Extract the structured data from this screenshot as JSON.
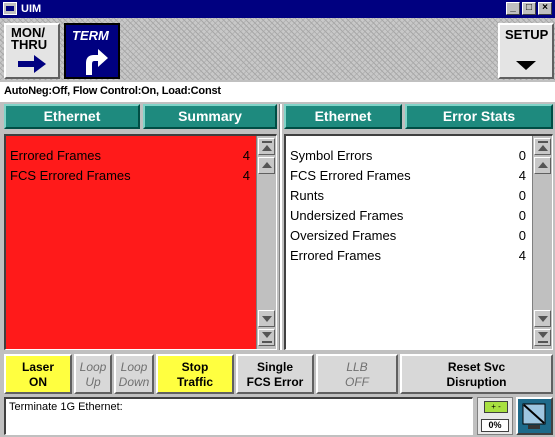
{
  "window": {
    "title": "UIM",
    "min": "_",
    "max": "□",
    "close": "×"
  },
  "toolbar": {
    "mon_thru": "MON/\nTHRU",
    "term": "TERM",
    "setup": "SETUP"
  },
  "status_line": "AutoNeg:Off, Flow Control:On, Load:Const",
  "left_panel": {
    "tab1": "Ethernet",
    "tab2": "Summary",
    "bg_color": "#ff1a1a",
    "rows": [
      {
        "label": "Errored Frames",
        "value": "4"
      },
      {
        "label": "FCS Errored Frames",
        "value": "4"
      }
    ]
  },
  "right_panel": {
    "tab1": "Ethernet",
    "tab2": "Error Stats",
    "rows": [
      {
        "label": "Symbol Errors",
        "value": "0"
      },
      {
        "label": "FCS Errored Frames",
        "value": "4"
      },
      {
        "label": "Runts",
        "value": "0"
      },
      {
        "label": "Undersized Frames",
        "value": "0"
      },
      {
        "label": "Oversized Frames",
        "value": "0"
      },
      {
        "label": "Errored Frames",
        "value": "4"
      }
    ]
  },
  "buttons": {
    "laser": {
      "l1": "Laser",
      "l2": "ON"
    },
    "loop_up": {
      "l1": "Loop",
      "l2": "Up"
    },
    "loop_down": {
      "l1": "Loop",
      "l2": "Down"
    },
    "stop_traffic": {
      "l1": "Stop",
      "l2": "Traffic"
    },
    "single_fcs": {
      "l1": "Single",
      "l2": "FCS Error"
    },
    "llb": {
      "l1": "LLB",
      "l2": "OFF"
    },
    "reset_svc": {
      "l1": "Reset Svc",
      "l2": "Disruption"
    }
  },
  "message": "Terminate 1G Ethernet:",
  "battery": {
    "cell": "+ -",
    "percent": "0%"
  },
  "colors": {
    "accent_teal": "#1e8a7e",
    "title_blue": "#000080",
    "active_yellow": "#ffff40",
    "alarm_red": "#ff1a1a"
  }
}
